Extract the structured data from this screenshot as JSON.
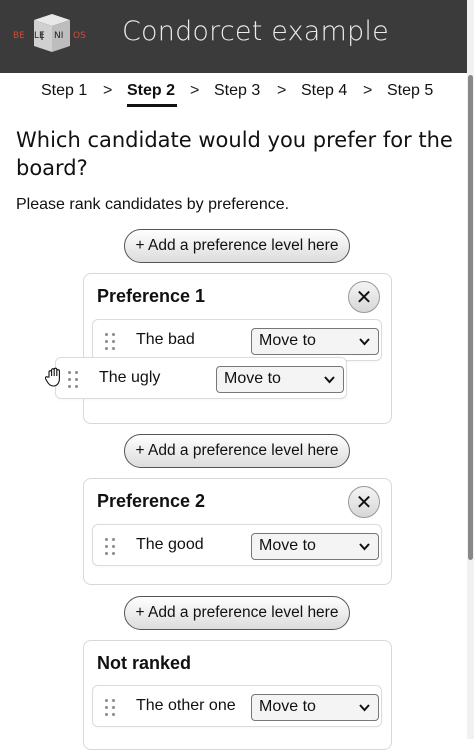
{
  "header": {
    "logo_text": "BELENIOS",
    "title": "Condorcet example"
  },
  "steps": [
    {
      "label": "Step 1"
    },
    {
      "label": "Step 2"
    },
    {
      "label": "Step 3"
    },
    {
      "label": "Step 4"
    },
    {
      "label": "Step 5"
    }
  ],
  "step_separator": ">",
  "question": "Which candidate would you prefer for the board?",
  "instructions": "Please rank candidates by preference.",
  "add_level_label": "+ Add a preference level here",
  "close_symbol": "✕",
  "move_to_label": "Move to",
  "groups": [
    {
      "title": "Preference 1",
      "candidates": [
        "The bad"
      ]
    },
    {
      "title": "Preference 2",
      "candidates": [
        "The good"
      ]
    },
    {
      "title": "Not ranked",
      "candidates": [
        "The other one"
      ]
    }
  ],
  "dragging_candidate": "The ugly",
  "colors": {
    "header_bg": "#3b3b3b",
    "logo_red": "#c0392b"
  }
}
